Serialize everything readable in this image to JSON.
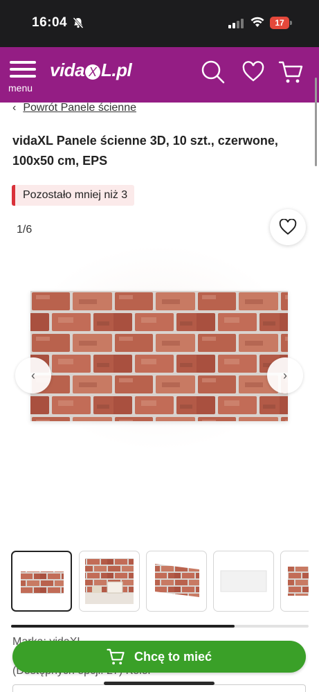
{
  "status_bar": {
    "time": "16:04",
    "battery": "17"
  },
  "header": {
    "menu_label": "menu",
    "logo": {
      "prefix": "vida",
      "x": "X",
      "suffix": "L.pl"
    },
    "brand_color": "#941d84",
    "icons": [
      "search-icon",
      "heart-icon",
      "cart-icon"
    ]
  },
  "breadcrumb": {
    "chevron": "‹",
    "label": "Powrót Panele ścienne"
  },
  "product": {
    "title": "vidaXL Panele ścienne 3D, 10 szt., czerwone, 100x50 cm, EPS",
    "stock_badge": "Pozostało mniej niż 3",
    "image_counter": "1/6",
    "carousel_progress": 0.75
  },
  "below_fold": {
    "line1": "Marka: vidaXL",
    "line2": "(Dostępnych opcji: 27) Kolor"
  },
  "cta": {
    "label": "Chcę to mieć",
    "color": "#3aa028"
  }
}
